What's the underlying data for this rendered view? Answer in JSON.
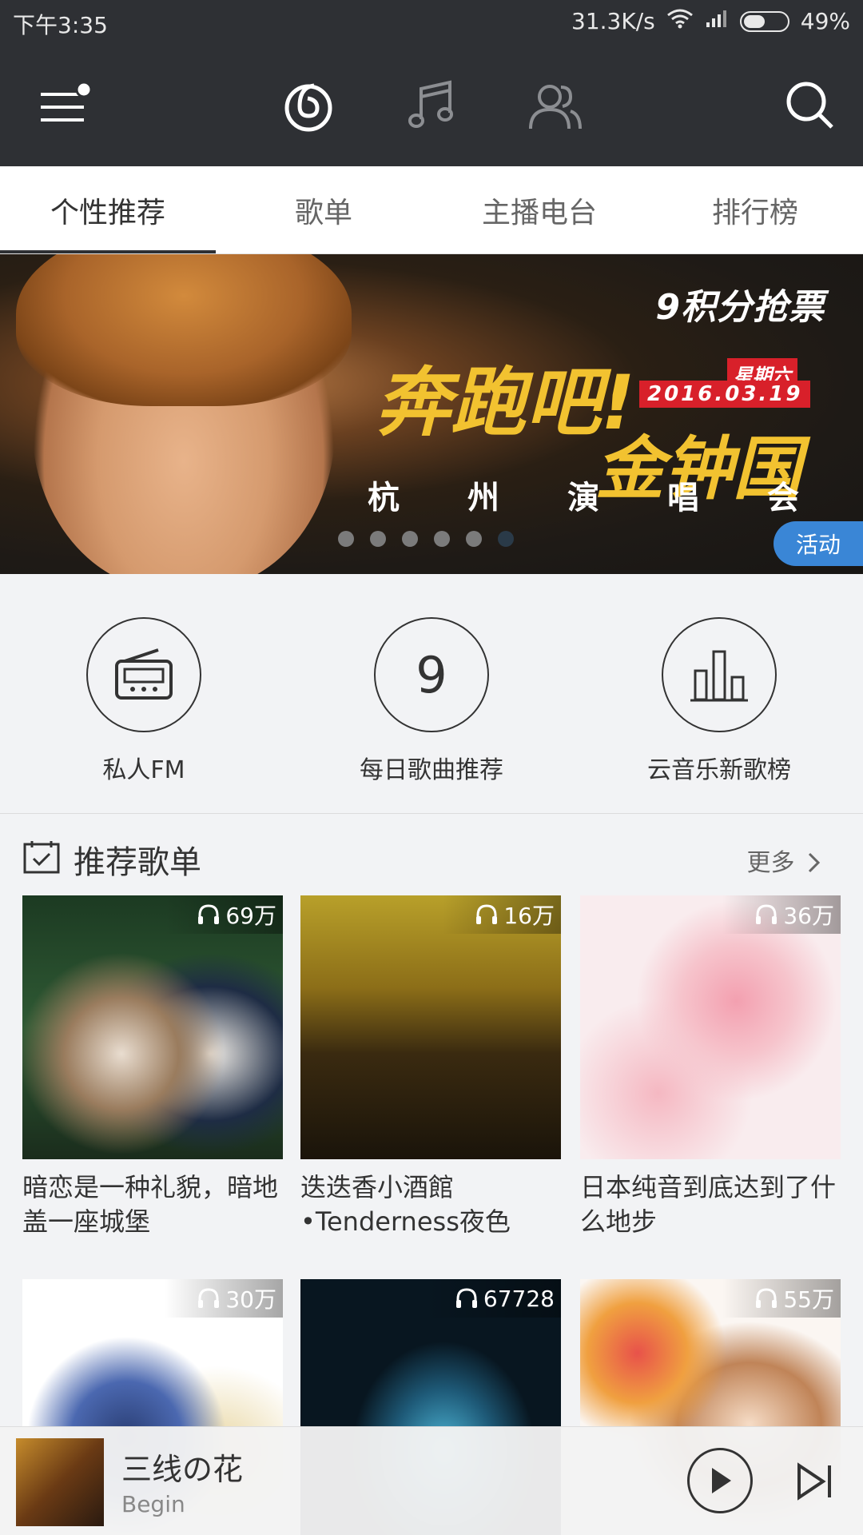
{
  "status_bar": {
    "time": "下午3:35",
    "speed": "31.3K/s",
    "battery": "49%"
  },
  "tabs": [
    "个性推荐",
    "歌单",
    "主播电台",
    "排行榜"
  ],
  "banner": {
    "badge": "9积分抢票",
    "title_line1": "奔跑吧!",
    "title_line2": "金钟国",
    "weekday": "星期六",
    "date": "2016.03.19",
    "subtitle": [
      "杭",
      "州",
      "演",
      "唱",
      "会"
    ],
    "tag": "活动",
    "dot_count": 6,
    "active_dot_index": 5
  },
  "quick_entries": {
    "fm_label": "私人FM",
    "daily_number": "9",
    "daily_label": "每日歌曲推荐",
    "chart_label": "云音乐新歌榜"
  },
  "section": {
    "title": "推荐歌单",
    "more": "更多"
  },
  "playlists": [
    {
      "plays": "69万",
      "title": "暗恋是一种礼貌，暗地盖一座城堡"
    },
    {
      "plays": "16万",
      "title": "迭迭香小酒館•Tenderness夜色"
    },
    {
      "plays": "36万",
      "title": "日本纯音到底达到了什么地步"
    },
    {
      "plays": "30万",
      "title": ""
    },
    {
      "plays": "67728",
      "title": ""
    },
    {
      "plays": "55万",
      "title": ""
    }
  ],
  "player": {
    "title": "三线の花",
    "artist": "Begin"
  },
  "colors": {
    "header_bg": "#2e3034",
    "accent_blue": "#3a86d6",
    "banner_gold": "#f2c230",
    "banner_red": "#d8202a"
  }
}
